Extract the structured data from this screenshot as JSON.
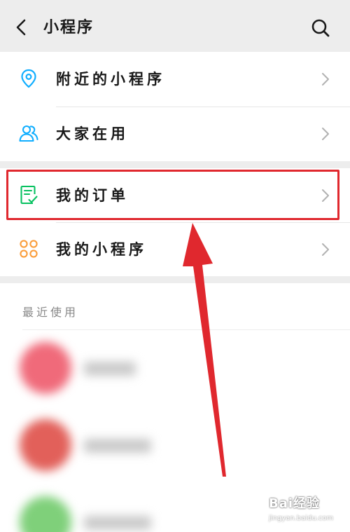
{
  "header": {
    "title": "小程序",
    "back_icon": "chevron-left-icon",
    "search_icon": "search-icon"
  },
  "menu_group_1": [
    {
      "label": "附近的小程序",
      "icon": "location-pin-icon",
      "icon_color": "#10aeff"
    },
    {
      "label": "大家在用",
      "icon": "people-icon",
      "icon_color": "#10aeff"
    }
  ],
  "menu_group_2": [
    {
      "label": "我的订单",
      "icon": "order-check-icon",
      "icon_color": "#07c160"
    },
    {
      "label": "我的小程序",
      "icon": "grid-circles-icon",
      "icon_color": "#fa9d3b"
    }
  ],
  "recent": {
    "title": "最近使用"
  },
  "annotation": {
    "highlight_color": "#e0282e",
    "arrow_color": "#e0282e"
  },
  "watermark": {
    "brand": "Bai经验",
    "url": "jingyan.baidu.com"
  }
}
